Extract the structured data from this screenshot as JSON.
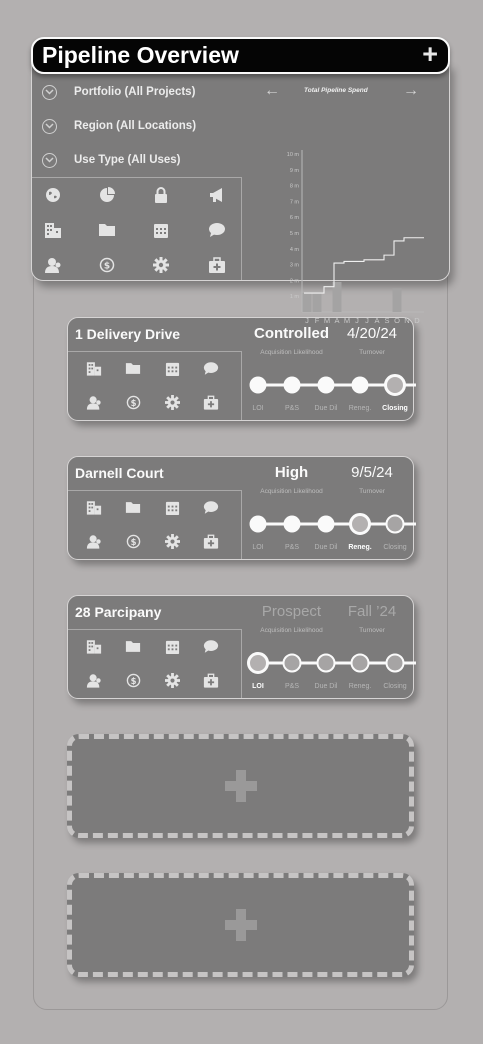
{
  "title": "Pipeline Overview",
  "add_symbol": "+",
  "filters": [
    {
      "label": "Portfolio (All Projects)"
    },
    {
      "label": "Region (All Locations)"
    },
    {
      "label": "Use Type (All Uses)"
    }
  ],
  "chart_data": {
    "type": "bar",
    "title": "Total Pipeline Spend",
    "categories": [
      "J",
      "F",
      "M",
      "A",
      "M",
      "J",
      "J",
      "A",
      "S",
      "O",
      "N",
      "D"
    ],
    "values": [
      1.2,
      1.2,
      0,
      1.9,
      0,
      0,
      0,
      0,
      0,
      1.5,
      0,
      0
    ],
    "line": [
      1.2,
      1.2,
      1.6,
      3.1,
      3.2,
      3.2,
      3.3,
      3.3,
      3.6,
      4.5,
      4.7,
      4.7
    ],
    "yticks": [
      "1 m",
      "2 m",
      "3 m",
      "4 m",
      "5 m",
      "6 m",
      "7 m",
      "8 m",
      "9 m",
      "10 m"
    ],
    "ylim": [
      0,
      10
    ]
  },
  "nav": {
    "prev": "←",
    "next": "→"
  },
  "stage_labels": [
    "LOI",
    "P&S",
    "Due Dil",
    "Reneg.",
    "Closing"
  ],
  "column_labels": {
    "likelihood": "Acquisition Likelihood",
    "turnover": "Turnover"
  },
  "projects": [
    {
      "name": "1 Delivery Drive",
      "likelihood": "Controlled",
      "turnover": "4/20/24",
      "current_stage": 4
    },
    {
      "name": "Darnell Court",
      "likelihood": "High",
      "turnover": "9/5/24",
      "current_stage": 3
    },
    {
      "name": "28 Parcipany",
      "likelihood": "Prospect",
      "turnover": "Fall ’24",
      "current_stage": 0
    }
  ],
  "icons": [
    "globe-icon",
    "pie-chart-icon",
    "lock-icon",
    "megaphone-icon",
    "buildings-icon",
    "folder-icon",
    "calendar-icon",
    "chat-icon",
    "users-icon",
    "dollar-icon",
    "gear-icon",
    "medical-kit-icon"
  ],
  "card_icons": [
    "buildings-icon",
    "folder-icon",
    "calendar-icon",
    "chat-icon",
    "users-icon",
    "dollar-icon",
    "gear-icon",
    "medical-kit-icon"
  ]
}
